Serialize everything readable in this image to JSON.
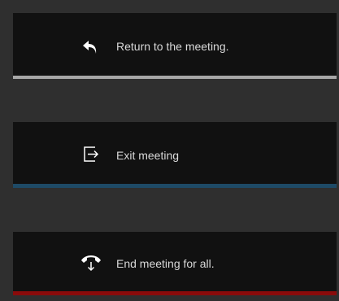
{
  "options": [
    {
      "icon": "return-arrow-icon",
      "label": "Return to the meeting.",
      "accent": "#a7a7a7"
    },
    {
      "icon": "exit-door-icon",
      "label": "Exit meeting",
      "accent": "#1e4a66"
    },
    {
      "icon": "hang-up-phone-icon",
      "label": "End meeting for all.",
      "accent": "#8a0b0b"
    }
  ],
  "colors": {
    "background": "#2f2f2f",
    "option_background": "#111111",
    "text": "#d9d9d9"
  }
}
